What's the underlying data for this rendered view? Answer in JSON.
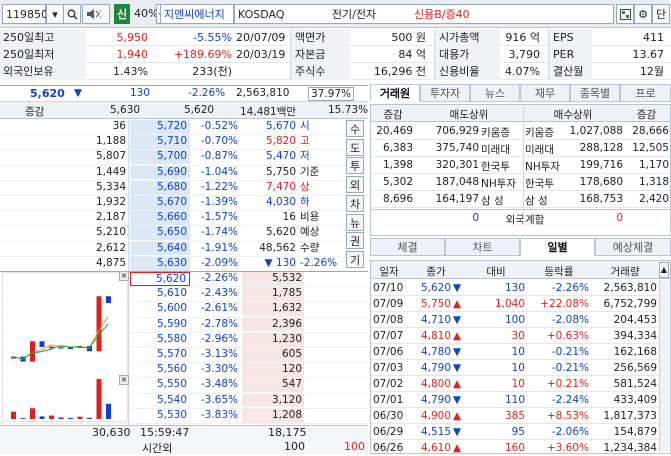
{
  "topbar": {
    "code": "119850",
    "badge": "신",
    "margin": "40%",
    "name": "지엔씨에너지",
    "market": "KOSDAQ",
    "sector": "전기/전자",
    "credit": "신용B/증40",
    "brand_color": "#1a8a3a"
  },
  "info": {
    "rows": [
      {
        "l1": "250일최고",
        "v1": "5,950",
        "v2": "-5.55%",
        "v3": "20/07/09",
        "l2": "액면가",
        "v4": "500 원",
        "l3": "시가총액",
        "v5": "916 억",
        "l4": "EPS",
        "v6": "411"
      },
      {
        "l1": "250일최저",
        "v1": "1,940",
        "v2": "+189.69%",
        "v3": "20/03/19",
        "l2": "자본금",
        "v4": "84 억",
        "l3": "대용가",
        "v5": "3,790",
        "l4": "PER",
        "v6": "13.67"
      },
      {
        "l1": "외국인보유",
        "v1": "1.43%",
        "v2": "233(천)",
        "v3": "",
        "l2": "주식수",
        "v4": "16,296 천",
        "l3": "신용비율",
        "v5": "4.07%",
        "l4": "결산월",
        "v6": "12월"
      }
    ]
  },
  "pricebar": {
    "price": "5,620",
    "arrow": "▼",
    "change": "130",
    "rate": "-2.26%",
    "amount": "2,563,810",
    "turnover": "37.97%"
  },
  "subbar": {
    "label": "증감",
    "p1": "5,630",
    "p2": "5,620",
    "volume": "14,481백만",
    "pct": "15.73%"
  },
  "asks": [
    {
      "qty": "36",
      "price": "5,720",
      "rate": "-0.52%"
    },
    {
      "qty": "1,188",
      "price": "5,710",
      "rate": "-0.70%"
    },
    {
      "qty": "5,807",
      "price": "5,700",
      "rate": "-0.87%"
    },
    {
      "qty": "1,449",
      "price": "5,690",
      "rate": "-1.04%"
    },
    {
      "qty": "5,334",
      "price": "5,680",
      "rate": "-1.22%"
    },
    {
      "qty": "1,932",
      "price": "5,670",
      "rate": "-1.39%"
    },
    {
      "qty": "2,187",
      "price": "5,660",
      "rate": "-1.57%"
    },
    {
      "qty": "5,210",
      "price": "5,650",
      "rate": "-1.74%"
    },
    {
      "qty": "2,612",
      "price": "5,640",
      "rate": "-1.91%"
    },
    {
      "qty": "4,875",
      "price": "5,630",
      "rate": "-2.09%"
    }
  ],
  "bids": [
    {
      "price": "5,620",
      "rate": "-2.26%",
      "qty": "5,532"
    },
    {
      "price": "5,610",
      "rate": "-2.43%",
      "qty": "1,785"
    },
    {
      "price": "5,600",
      "rate": "-2.61%",
      "qty": "1,632"
    },
    {
      "price": "5,590",
      "rate": "-2.78%",
      "qty": "2,396"
    },
    {
      "price": "5,580",
      "rate": "-2.96%",
      "qty": "1,230"
    },
    {
      "price": "5,570",
      "rate": "-3.13%",
      "qty": "605"
    },
    {
      "price": "5,560",
      "rate": "-3.30%",
      "qty": "120"
    },
    {
      "price": "5,550",
      "rate": "-3.48%",
      "qty": "547"
    },
    {
      "price": "5,540",
      "rate": "-3.65%",
      "qty": "3,120"
    },
    {
      "price": "5,530",
      "rate": "-3.83%",
      "qty": "1,208"
    }
  ],
  "summary": [
    {
      "val": "5,670",
      "lbl": "시"
    },
    {
      "val": "5,820",
      "lbl": "고"
    },
    {
      "val": "5,470",
      "lbl": "저"
    },
    {
      "val": "5,750",
      "lbl": "기준"
    },
    {
      "val": "7,470",
      "lbl": "상"
    },
    {
      "val": "4,030",
      "lbl": "하"
    },
    {
      "val": "16",
      "lbl": "비용"
    },
    {
      "val": "5,620",
      "lbl": "예상"
    },
    {
      "val": "48,562",
      "lbl": "수량"
    },
    {
      "val": "▼ 130",
      "lbl": "-2.26%"
    }
  ],
  "side_buttons": [
    "수",
    "도",
    "투",
    "외",
    "차",
    "뉴",
    "권",
    "기"
  ],
  "footer": {
    "total_ask": "30,630",
    "time": "15:59:47",
    "total_bid": "18,175",
    "label": "시간외",
    "v1": "100",
    "v2": "100"
  },
  "right_tabs_top": [
    "거래원",
    "투자자",
    "뉴스",
    "재무",
    "종목별",
    "프로"
  ],
  "broker": {
    "headers": [
      "증감",
      "매도상위",
      "매수상위",
      "증감"
    ],
    "rows": [
      {
        "c1": "20,469",
        "s": "706,929",
        "sn": "키움증",
        "bn": "키움증",
        "b": "1,027,088",
        "c2": "28,666"
      },
      {
        "c1": "6,383",
        "s": "375,740",
        "sn": "미래대",
        "bn": "미래대",
        "b": "288,128",
        "c2": "12,505"
      },
      {
        "c1": "1,398",
        "s": "320,301",
        "sn": "한국투",
        "bn": "NH투자",
        "b": "199,716",
        "c2": "1,170"
      },
      {
        "c1": "5,302",
        "s": "187,048",
        "sn": "NH투자",
        "bn": "한국투",
        "b": "178,680",
        "c2": "1,318"
      },
      {
        "c1": "8,696",
        "s": "164,197",
        "sn": "삼 성",
        "bn": "삼 성",
        "b": "168,753",
        "c2": "2,420"
      }
    ],
    "foreign": {
      "c1": "0",
      "label": "외국계합",
      "c2": "0"
    }
  },
  "right_tabs_bottom": [
    "체결",
    "차트",
    "일별",
    "예상체결"
  ],
  "daily": {
    "headers": [
      "일자",
      "종가",
      "대비",
      "등락률",
      "거래량"
    ],
    "rows": [
      {
        "date": "07/10",
        "close": "5,620",
        "dir": "down",
        "diff": "130",
        "rate": "-2.26%",
        "vol": "2,563,810"
      },
      {
        "date": "07/09",
        "close": "5,750",
        "dir": "up",
        "diff": "1,040",
        "rate": "+22.08%",
        "vol": "6,752,799"
      },
      {
        "date": "07/08",
        "close": "4,710",
        "dir": "down",
        "diff": "100",
        "rate": "-2.08%",
        "vol": "204,453"
      },
      {
        "date": "07/07",
        "close": "4,810",
        "dir": "up",
        "diff": "30",
        "rate": "+0.63%",
        "vol": "394,334"
      },
      {
        "date": "07/06",
        "close": "4,780",
        "dir": "down",
        "diff": "10",
        "rate": "-0.21%",
        "vol": "162,168"
      },
      {
        "date": "07/03",
        "close": "4,790",
        "dir": "down",
        "diff": "10",
        "rate": "-0.21%",
        "vol": "256,569"
      },
      {
        "date": "07/02",
        "close": "4,800",
        "dir": "up",
        "diff": "10",
        "rate": "+0.21%",
        "vol": "581,524"
      },
      {
        "date": "07/01",
        "close": "4,790",
        "dir": "down",
        "diff": "110",
        "rate": "-2.24%",
        "vol": "433,409"
      },
      {
        "date": "06/30",
        "close": "4,900",
        "dir": "up",
        "diff": "385",
        "rate": "+8.53%",
        "vol": "1,817,373"
      },
      {
        "date": "06/29",
        "close": "4,515",
        "dir": "down",
        "diff": "95",
        "rate": "-2.06%",
        "vol": "154,879"
      },
      {
        "date": "06/26",
        "close": "4,610",
        "dir": "up",
        "diff": "160",
        "rate": "+3.60%",
        "vol": "1,234,384"
      }
    ]
  }
}
